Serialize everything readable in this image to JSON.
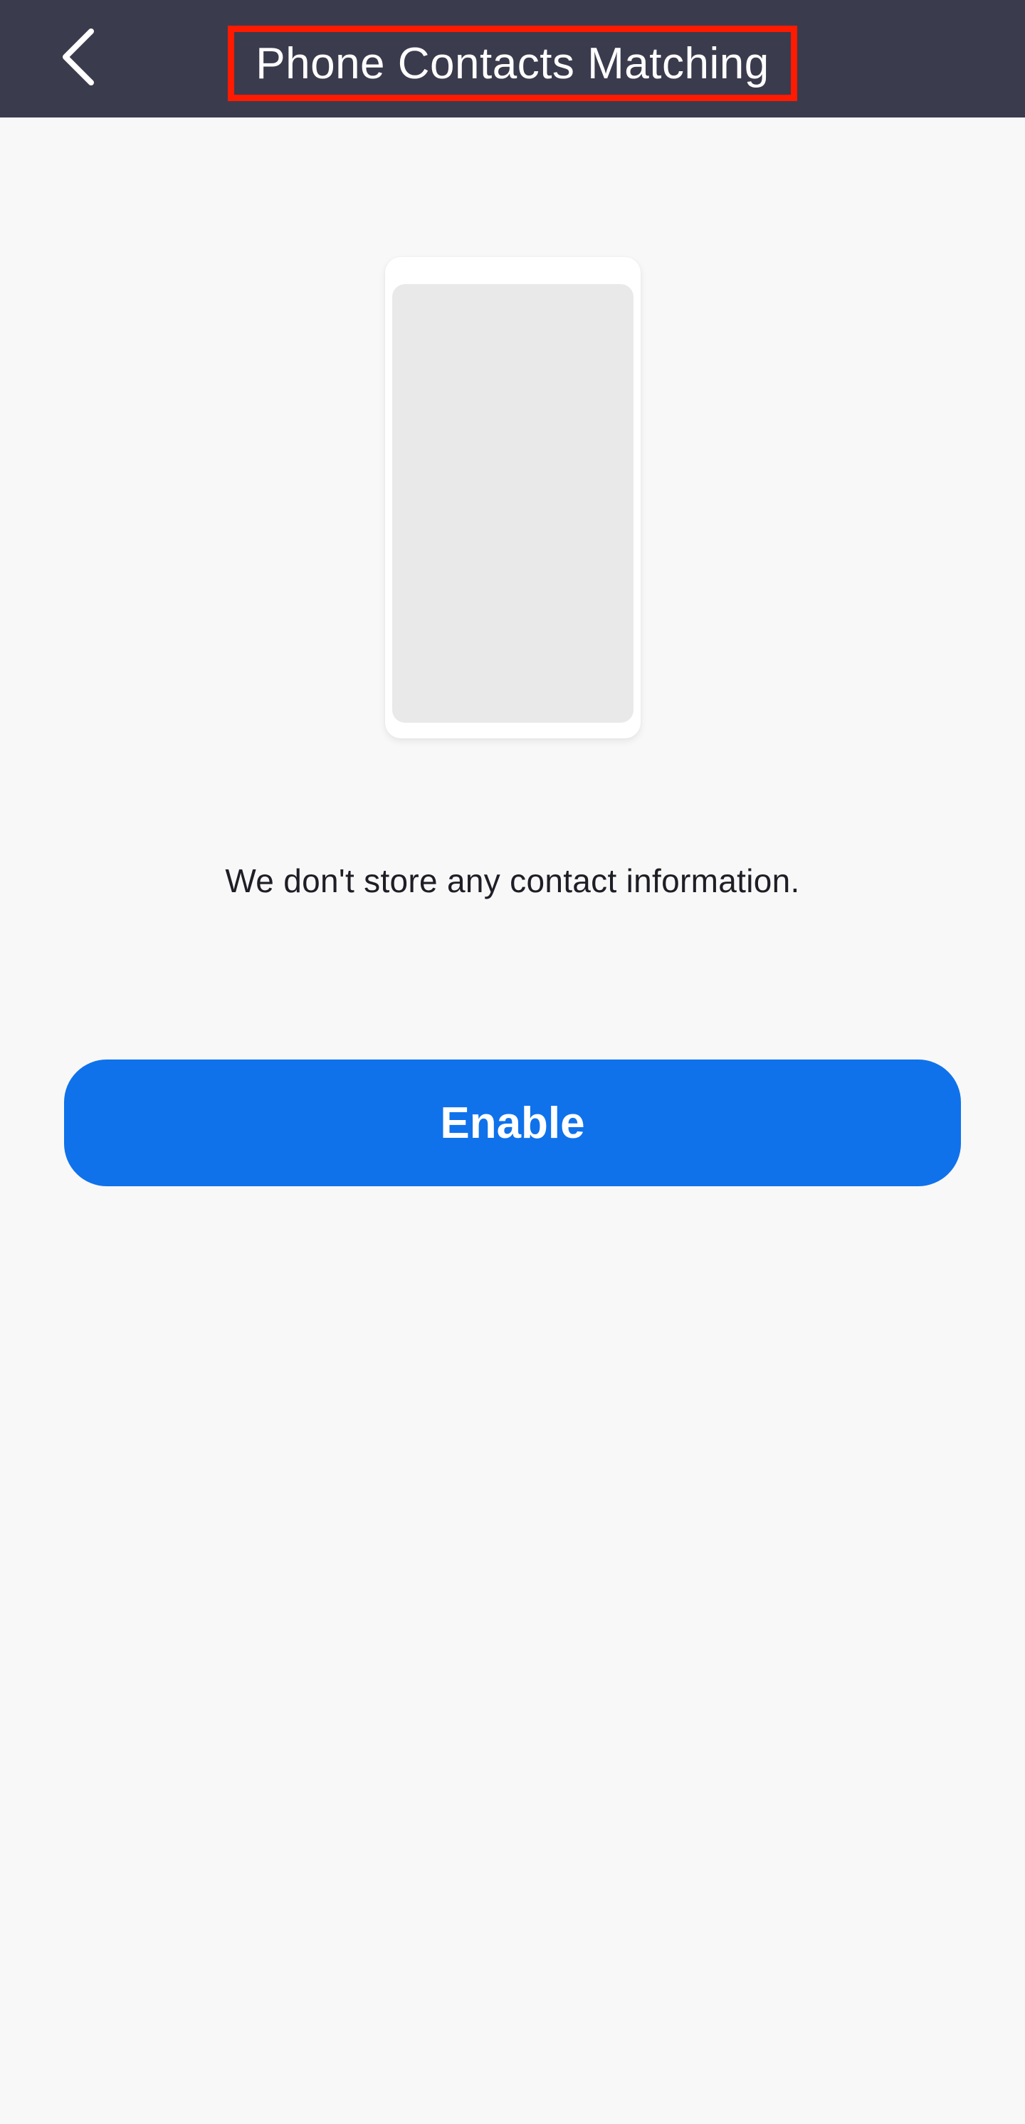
{
  "header": {
    "title": "Phone Contacts Matching",
    "back_icon": "chevron-left-icon",
    "background_color": "#3b3b4e",
    "highlight_color": "#ff1a00"
  },
  "main": {
    "illustration_icon": "phone-illustration",
    "info_text": "We don't store any contact information.",
    "enable_label": "Enable",
    "accent_color": "#0f72eb"
  }
}
